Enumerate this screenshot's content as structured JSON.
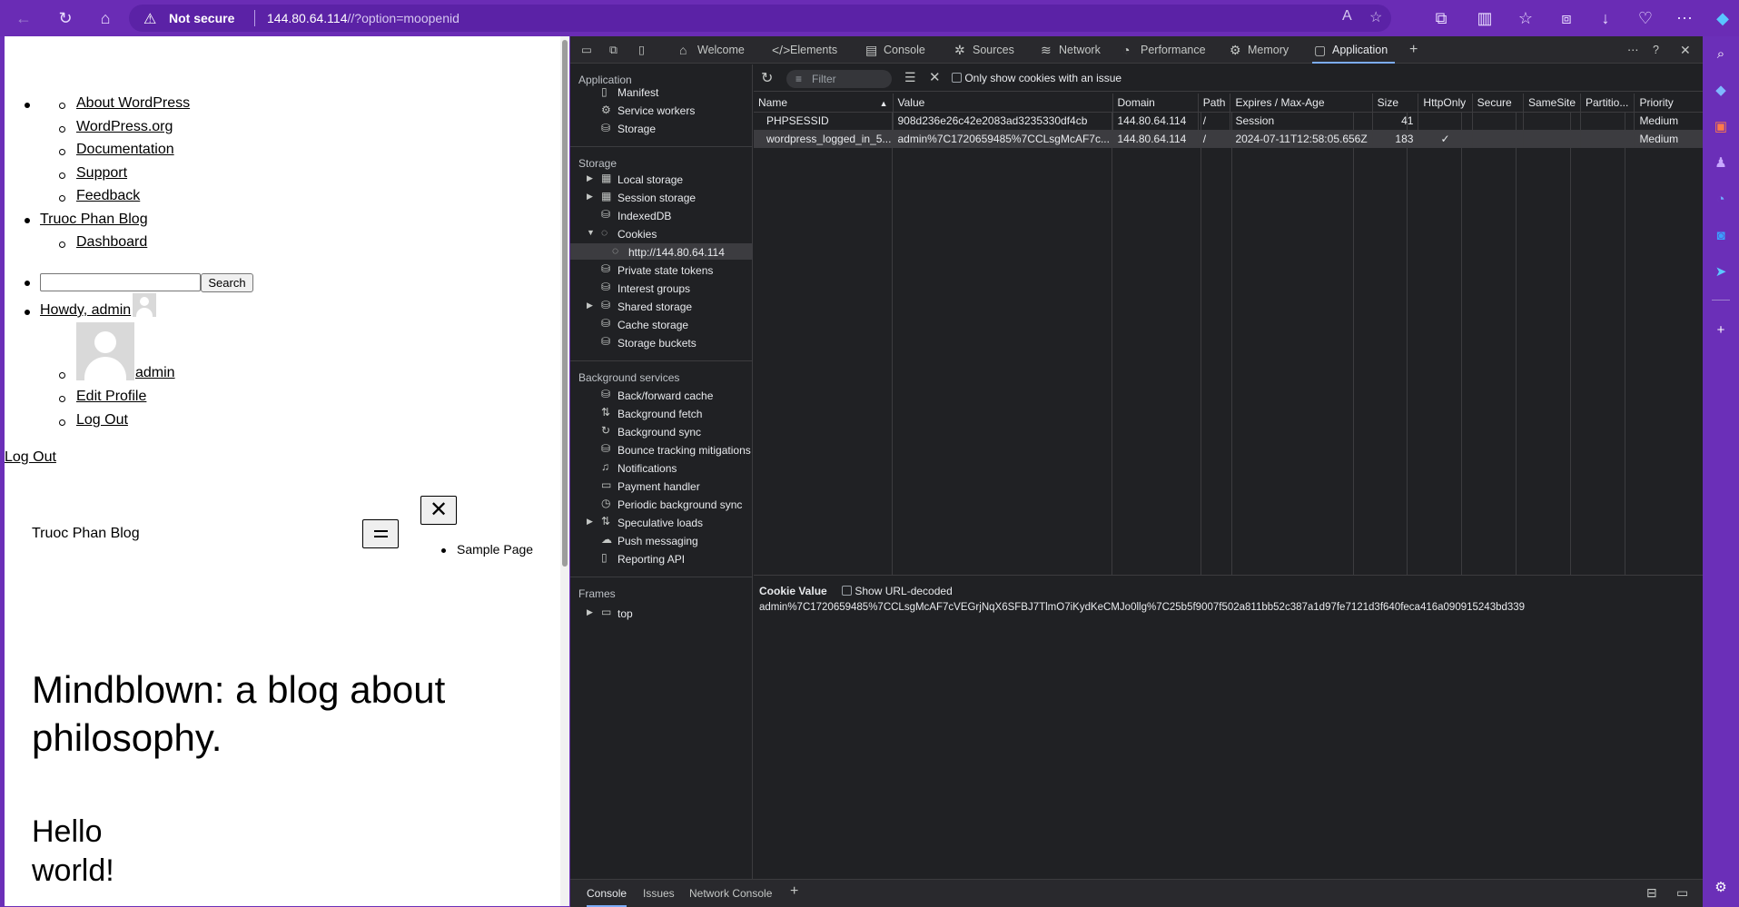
{
  "browser": {
    "security_label": "Not secure",
    "url_host": "144.80.64.114",
    "url_path": "//?option=moopenid"
  },
  "webpage": {
    "admin_menu": [
      "About WordPress",
      "WordPress.org",
      "Documentation",
      "Support",
      "Feedback"
    ],
    "site_name_link": "Truoc Phan Blog",
    "dashboard_link": "Dashboard",
    "search_button": "Search",
    "howdy": "Howdy, admin",
    "user_name": "admin",
    "edit_profile": "Edit Profile",
    "log_out": "Log Out",
    "log_out_2": "Log Out",
    "site_title": "Truoc Phan Blog",
    "nav_item": "Sample Page",
    "tagline_line1": "Mindblown: a blog about",
    "tagline_line2": "philosophy.",
    "post_line1": "Hello",
    "post_line2": "world!"
  },
  "devtools": {
    "tabs": [
      "Welcome",
      "Elements",
      "Console",
      "Sources",
      "Network",
      "Performance",
      "Memory",
      "Application"
    ],
    "sidebar": {
      "application_header": "Application",
      "application_items": [
        "Manifest",
        "Service workers",
        "Storage"
      ],
      "storage_header": "Storage",
      "storage_items": [
        "Local storage",
        "Session storage",
        "IndexedDB",
        "Cookies"
      ],
      "cookie_origin": "http://144.80.64.114",
      "storage_items_2": [
        "Private state tokens",
        "Interest groups",
        "Shared storage",
        "Cache storage",
        "Storage buckets"
      ],
      "background_header": "Background services",
      "background_items": [
        "Back/forward cache",
        "Background fetch",
        "Background sync",
        "Bounce tracking mitigations",
        "Notifications",
        "Payment handler",
        "Periodic background sync",
        "Speculative loads",
        "Push messaging",
        "Reporting API"
      ],
      "frames_header": "Frames",
      "frames_items": [
        "top"
      ]
    },
    "toolbar": {
      "filter_placeholder": "Filter",
      "issue_only_label": "Only show cookies with an issue"
    },
    "columns": [
      "Name",
      "Value",
      "Domain",
      "Path",
      "Expires / Max-Age",
      "Size",
      "HttpOnly",
      "Secure",
      "SameSite",
      "Partitio...",
      "Priority"
    ],
    "rows": [
      {
        "name": "PHPSESSID",
        "value": "908d236e26c42e2083ad3235330df4cb",
        "domain": "144.80.64.114",
        "path": "/",
        "expires": "Session",
        "size": "41",
        "httponly": "",
        "secure": "",
        "samesite": "",
        "partition": "",
        "priority": "Medium"
      },
      {
        "name": "wordpress_logged_in_5...",
        "value": "admin%7C1720659485%7CCLsgMcAF7c...",
        "domain": "144.80.64.114",
        "path": "/",
        "expires": "2024-07-11T12:58:05.656Z",
        "size": "183",
        "httponly": "✓",
        "secure": "",
        "samesite": "",
        "partition": "",
        "priority": "Medium"
      }
    ],
    "cookie_value_label": "Cookie Value",
    "show_decoded_label": "Show URL-decoded",
    "cookie_value": "admin%7C1720659485%7CCLsgMcAF7cVEGrjNqX6SFBJ7TlmO7iKydKeCMJo0llg%7C25b5f9007f502a811bb52c387a1d97fe7121d3f640feca416a090915243bd339",
    "bottom_tabs": [
      "Console",
      "Issues",
      "Network Console"
    ]
  }
}
